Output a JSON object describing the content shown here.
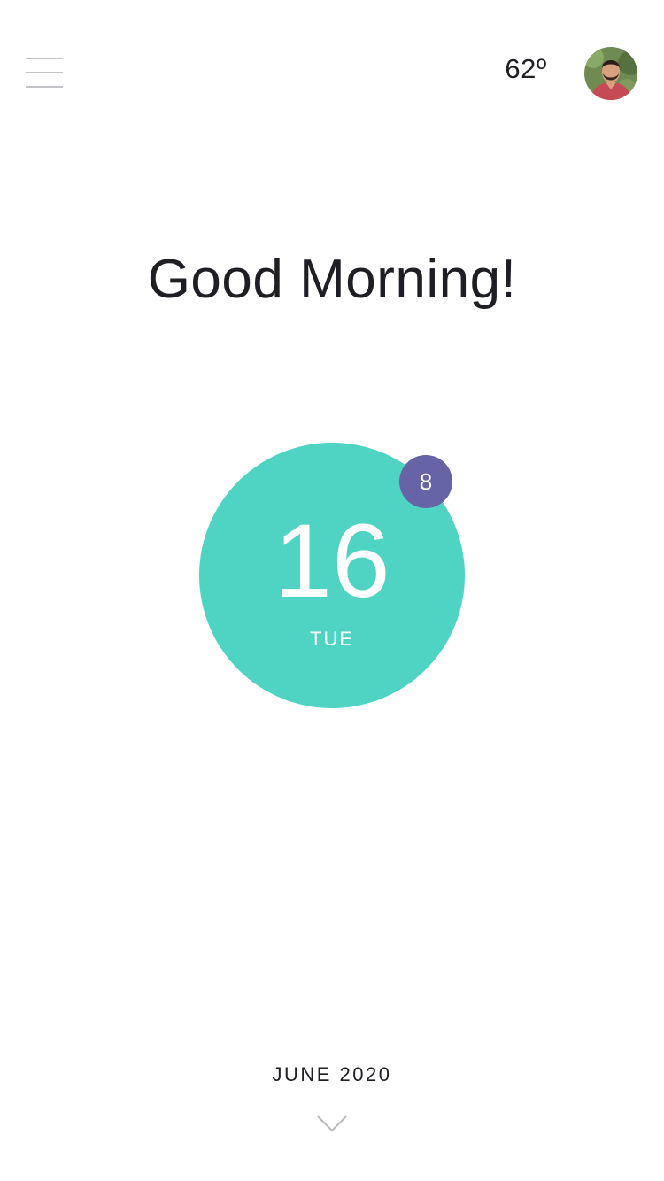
{
  "header": {
    "menu_icon": "hamburger-menu-icon",
    "temperature": "62º",
    "avatar_icon": "user-avatar"
  },
  "main": {
    "greeting": "Good Morning!",
    "date": {
      "day_number": "16",
      "day_name": "TUE",
      "badge_count": "8"
    }
  },
  "footer": {
    "month_year": "JUNE 2020",
    "expand_icon": "chevron-down-icon"
  },
  "colors": {
    "accent": "#4fd4c4",
    "badge": "#6664a6",
    "text": "#1e1e24",
    "menu_lines": "#c4c4c8"
  }
}
